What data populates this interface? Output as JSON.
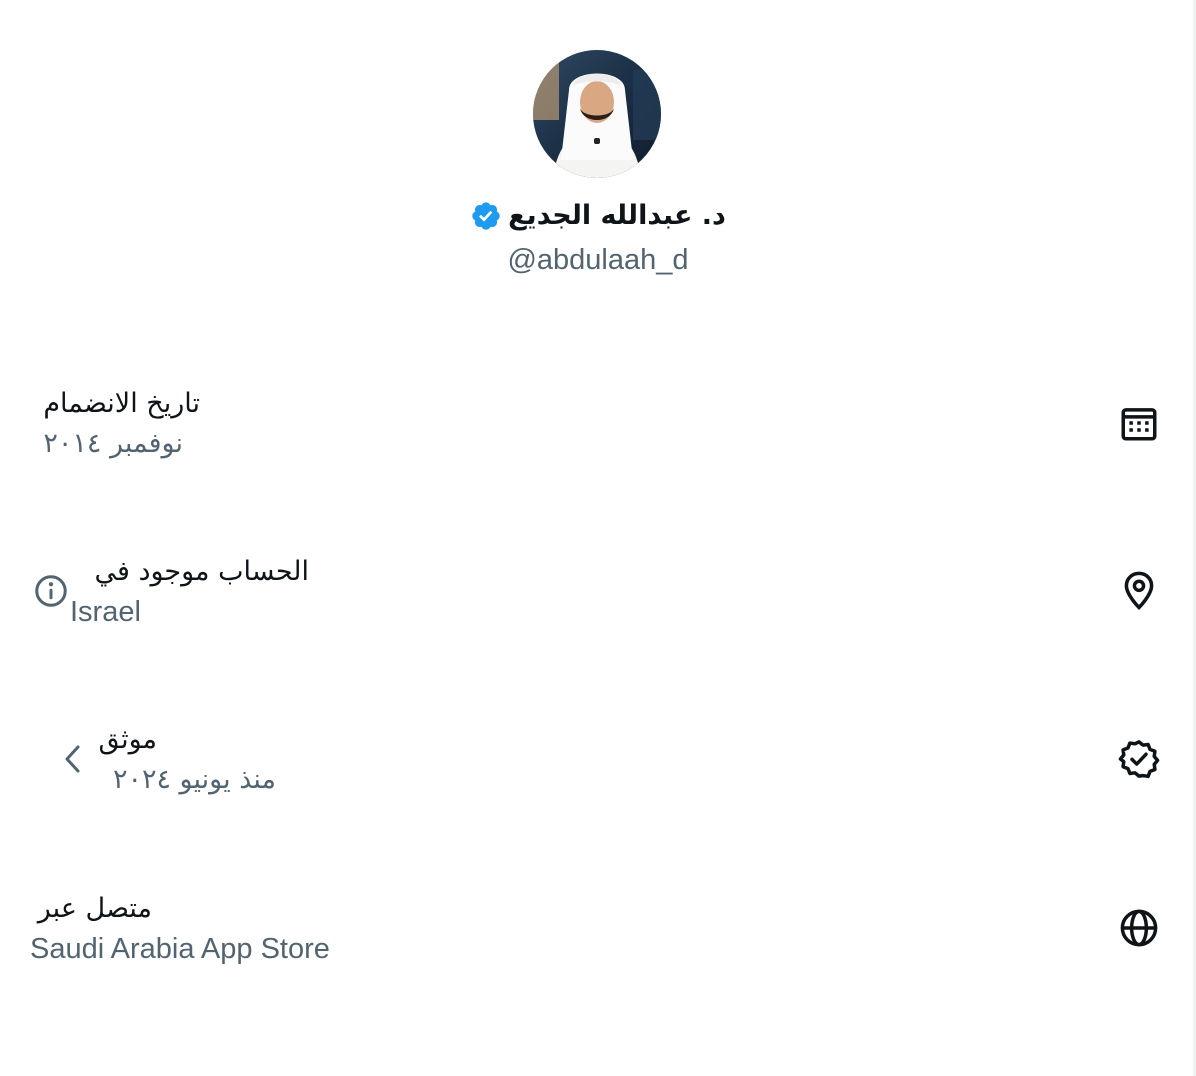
{
  "profile": {
    "display_name": "د. عبدالله الجديع",
    "handle": "@abdulaah_d",
    "verified": true,
    "accent_color": "#1d9bf0",
    "avatar_icon": "profile-photo"
  },
  "about_rows": [
    {
      "icon": "calendar-icon",
      "label": "تاريخ الانضمام",
      "value": "نوفمبر ٢٠١٤"
    },
    {
      "icon": "location-pin-icon",
      "label": "الحساب موجود في",
      "value": "Israel",
      "extra_icon": "info-icon"
    },
    {
      "icon": "verified-badge-icon",
      "label": "موثق",
      "value": "منذ يونيو ٢٠٢٤",
      "extra_icon": "chevron-left-icon"
    },
    {
      "icon": "globe-icon",
      "label": "متصل عبر",
      "value": "Saudi Arabia App Store"
    }
  ],
  "colors": {
    "primary_text": "#0f1419",
    "secondary_text": "#536471",
    "verified_blue": "#1d9bf0"
  }
}
